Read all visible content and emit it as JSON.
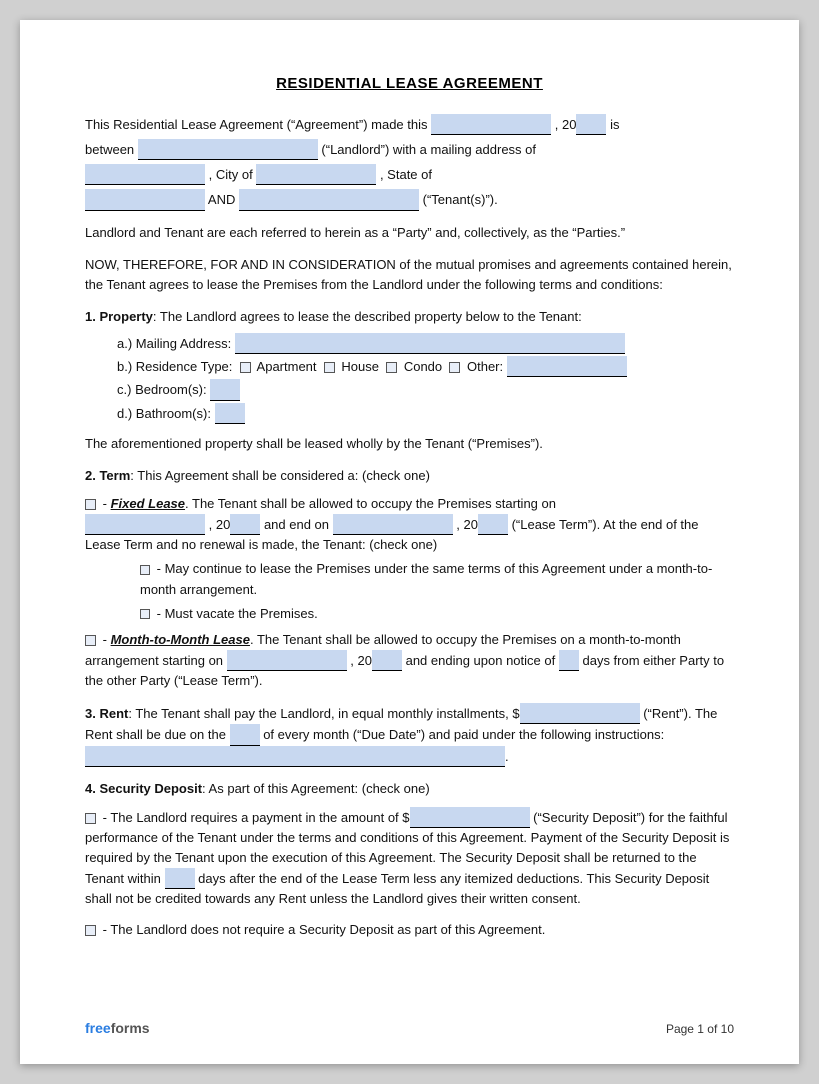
{
  "title": "RESIDENTIAL LEASE AGREEMENT",
  "intro": {
    "line1_a": "This Residential Lease Agreement (“Agreement”) made this",
    "line1_b": ", 20",
    "line1_c": "is",
    "line2_a": "between",
    "line2_b": "(“Landlord”) with a mailing address of",
    "line3_a": ", City of",
    "line3_b": ", State of",
    "line4_a": "AND",
    "line4_b": "(“Tenant(s)”)."
  },
  "paragraph1": "Landlord and Tenant are each referred to herein as a “Party” and, collectively, as the “Parties.”",
  "paragraph2": "NOW, THEREFORE, FOR AND IN CONSIDERATION of the mutual promises and agreements contained herein, the Tenant agrees to lease the Premises from the Landlord under the following terms and conditions:",
  "section1": {
    "label": "1. Property",
    "text": ": The Landlord agrees to lease the described property below to the Tenant:",
    "a_label": "a.)",
    "a_text": "Mailing Address:",
    "b_label": "b.)",
    "b_text": "Residence Type:",
    "b_apt": "Apartment",
    "b_house": "House",
    "b_condo": "Condo",
    "b_other": "Other:",
    "c_label": "c.)",
    "c_text": "Bedroom(s):",
    "d_label": "d.)",
    "d_text": "Bathroom(s):",
    "closing": "The aforementioned property shall be leased wholly by the Tenant (“Premises”)."
  },
  "section2": {
    "label": "2. Term",
    "text": ": This Agreement shall be considered a: (check one)",
    "fixed_label": "Fixed Lease",
    "fixed_text1": ". The Tenant shall be allowed to occupy the Premises starting on",
    "fixed_text2": ", 20",
    "fixed_text3": "and end on",
    "fixed_text4": ", 20",
    "fixed_text5": "(“Lease Term”). At the end of the Lease Term and no renewal is made, the Tenant: (check one)",
    "sub1_text": "- May continue to lease the Premises under the same terms of this Agreement under a month-to-month arrangement.",
    "sub2_text": "- Must vacate the Premises.",
    "month_label": "Month-to-Month Lease",
    "month_text1": ". The Tenant shall be allowed to occupy the Premises on a month-to-month arrangement starting on",
    "month_text2": ", 20",
    "month_text3": "and ending upon notice of",
    "month_text4": "days from either Party to the other Party (“Lease Term”)."
  },
  "section3": {
    "label": "3. Rent",
    "text1": ": The Tenant shall pay the Landlord, in equal monthly installments, $",
    "text2": "(“Rent”). The Rent shall be due on the",
    "text3": "of every month (“Due Date”) and paid under the following instructions:",
    "text4": "."
  },
  "section4": {
    "label": "4. Security Deposit",
    "text": ": As part of this Agreement: (check one)",
    "option1_text1": "- The Landlord requires a payment in the amount of $",
    "option1_text2": "(“Security Deposit”) for the faithful performance of the Tenant under the terms and conditions of this Agreement. Payment of the Security Deposit is required by the Tenant upon the execution of this Agreement. The Security Deposit shall be returned to the Tenant within",
    "option1_text3": "days after the end of the Lease Term less any itemized deductions. This Security Deposit shall not be credited towards any Rent unless the Landlord gives their written consent.",
    "option2_text": "- The Landlord does not require a Security Deposit as part of this Agreement."
  },
  "footer": {
    "logo_free": "free",
    "logo_forms": "forms",
    "page_text": "Page 1 of 10"
  }
}
